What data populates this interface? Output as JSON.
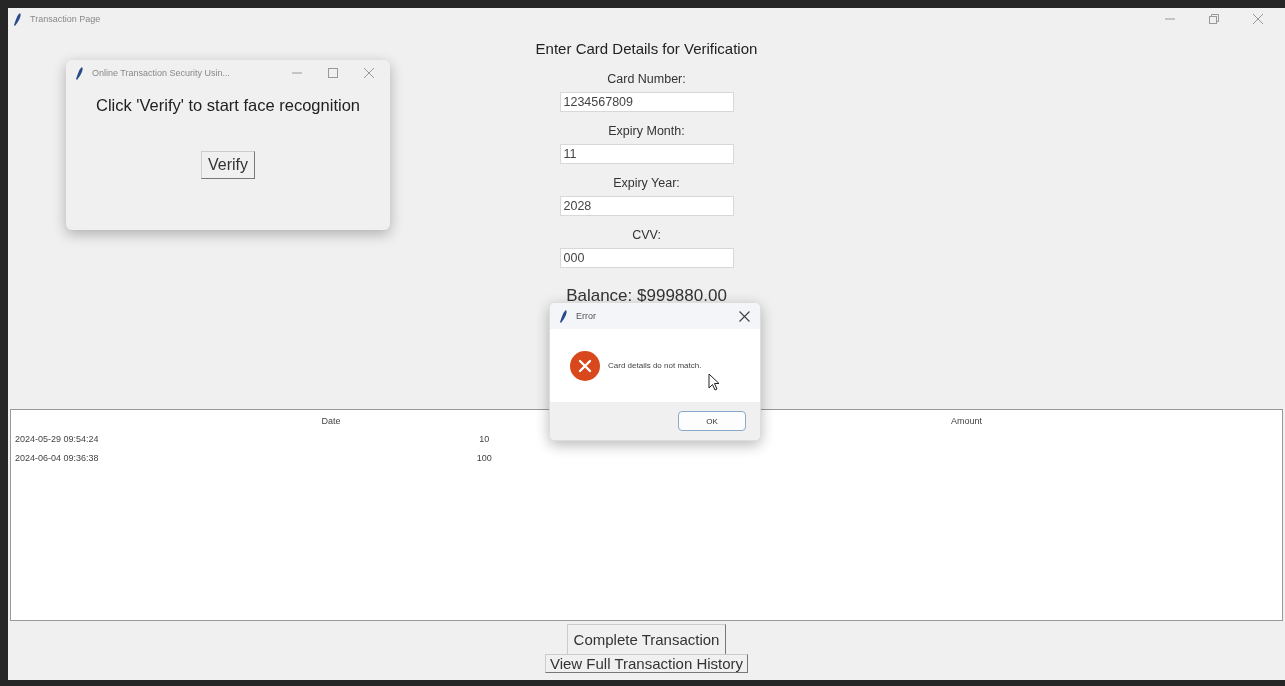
{
  "window": {
    "title": "Transaction Page"
  },
  "form": {
    "heading": "Enter Card Details for Verification",
    "fields": [
      {
        "label": "Card Number:",
        "value": "1234567809"
      },
      {
        "label": "Expiry Month:",
        "value": "11"
      },
      {
        "label": "Expiry Year:",
        "value": "2028"
      },
      {
        "label": "CVV:",
        "value": "000"
      }
    ],
    "balance": "Balance: $999880.00"
  },
  "table": {
    "columns": [
      "Date",
      "",
      "Amount"
    ],
    "rows": [
      [
        "2024-05-29 09:54:24",
        "10",
        ""
      ],
      [
        "2024-06-04 09:36:38",
        "100",
        ""
      ]
    ]
  },
  "buttons": [
    {
      "label": "Complete Transaction"
    },
    {
      "label": "View Full Transaction History"
    }
  ],
  "verify_dialog": {
    "title": "Online Transaction Security Usin...",
    "message": "Click 'Verify' to start face recognition",
    "button": "Verify"
  },
  "error_dialog": {
    "title": "Error",
    "message": "Card details do not match.",
    "button": "OK"
  }
}
